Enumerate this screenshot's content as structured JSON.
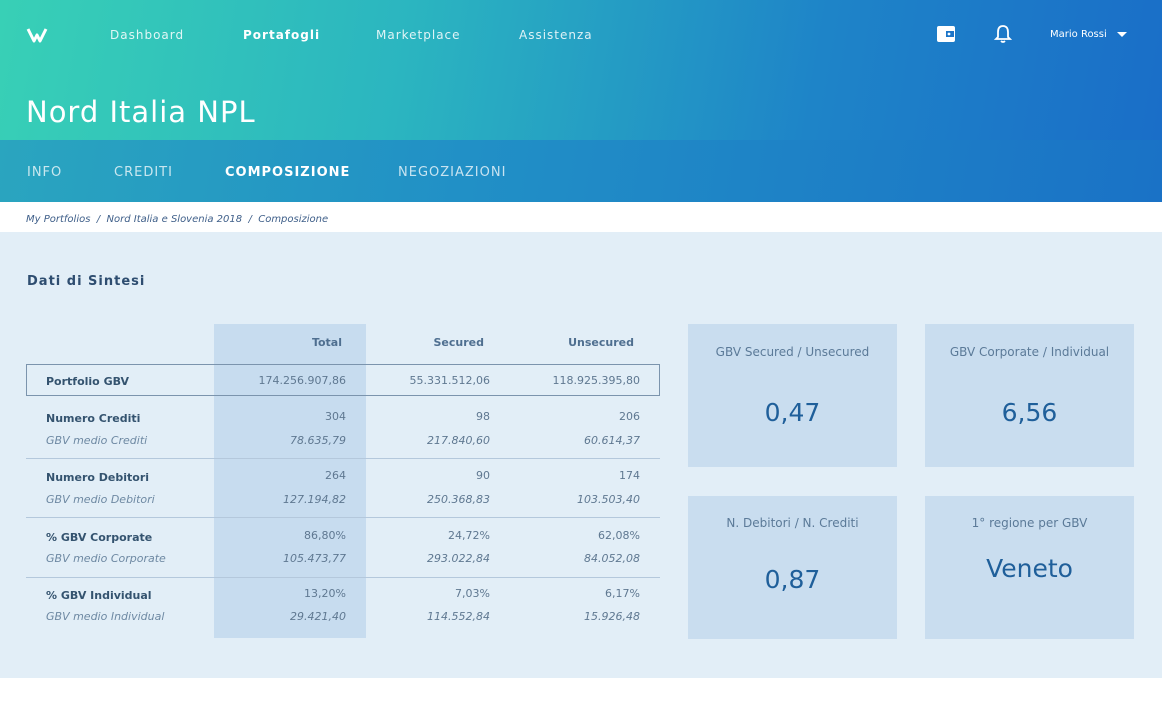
{
  "nav": {
    "items": [
      {
        "label": "Dashboard"
      },
      {
        "label": "Portafogli"
      },
      {
        "label": "Marketplace"
      },
      {
        "label": "Assistenza"
      }
    ],
    "user": "Mario Rossi"
  },
  "page": {
    "title": "Nord Italia NPL"
  },
  "tabs": [
    {
      "label": "INFO"
    },
    {
      "label": "CREDITI"
    },
    {
      "label": "COMPOSIZIONE"
    },
    {
      "label": "NEGOZIAZIONI"
    }
  ],
  "breadcrumb": "My Portfolios  /  Nord Italia e Slovenia 2018  /  Composizione",
  "section_title": "Dati di Sintesi",
  "table": {
    "headers": [
      "Total",
      "Secured",
      "Unsecured"
    ],
    "rows": [
      {
        "label": "Portfolio GBV",
        "values": [
          "174.256.907,86",
          "55.331.512,06",
          "118.925.395,80"
        ]
      },
      {
        "label": "Numero Crediti",
        "values": [
          "304",
          "98",
          "206"
        ]
      },
      {
        "label": "GBV medio Crediti",
        "values": [
          "78.635,79",
          "217.840,60",
          "60.614,37"
        ]
      },
      {
        "label": "Numero Debitori",
        "values": [
          "264",
          "90",
          "174"
        ]
      },
      {
        "label": "GBV medio Debitori",
        "values": [
          "127.194,82",
          "250.368,83",
          "103.503,40"
        ]
      },
      {
        "label": "% GBV Corporate",
        "values": [
          "86,80%",
          "24,72%",
          "62,08%"
        ]
      },
      {
        "label": "GBV medio Corporate",
        "values": [
          "105.473,77",
          "293.022,84",
          "84.052,08"
        ]
      },
      {
        "label": "% GBV Individual",
        "values": [
          "13,20%",
          "7,03%",
          "6,17%"
        ]
      },
      {
        "label": "GBV medio Individual",
        "values": [
          "29.421,40",
          "114.552,84",
          "15.926,48"
        ]
      }
    ]
  },
  "cards": [
    {
      "title": "GBV Secured / Unsecured",
      "value": "0,47"
    },
    {
      "title": "GBV Corporate / Individual",
      "value": "6,56"
    },
    {
      "title": "N. Debitori / N. Crediti",
      "value": "0,87"
    },
    {
      "title": "1° regione per GBV",
      "value": "Veneto"
    }
  ]
}
